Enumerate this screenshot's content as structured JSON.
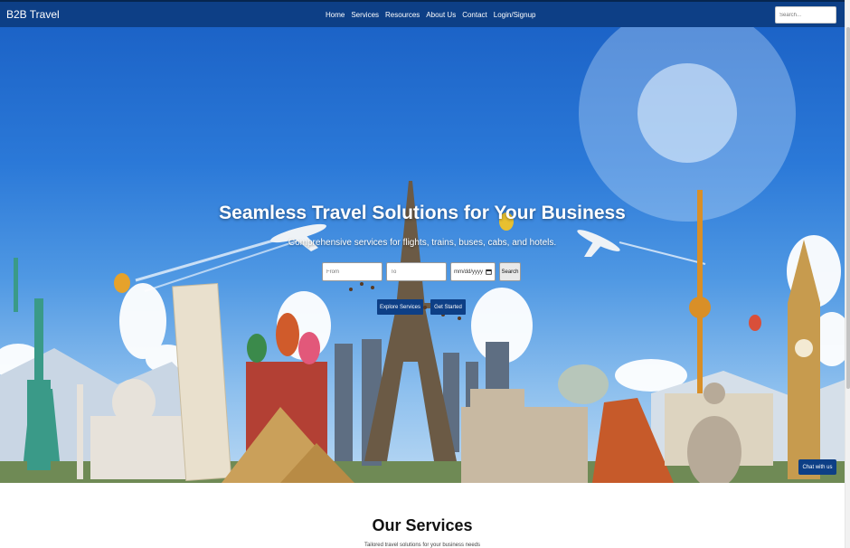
{
  "navbar": {
    "brand": "B2B Travel",
    "links": [
      "Home",
      "Services",
      "Resources",
      "About Us",
      "Contact",
      "Login/Signup"
    ],
    "search_placeholder": "Search..."
  },
  "hero": {
    "title": "Seamless Travel Solutions for Your Business",
    "subtitle": "Comprehensive services for flights, trains, buses, cabs, and hotels.",
    "search": {
      "from_placeholder": "From",
      "to_placeholder": "To",
      "date_placeholder": "mm/dd/yyyy",
      "button": "Search"
    },
    "buttons": {
      "explore": "Explore Services",
      "start": "Get Started"
    }
  },
  "chat": {
    "label": "Chat with us"
  },
  "services": {
    "title": "Our Services",
    "subtitle": "Tailored travel solutions for your business needs"
  },
  "colors": {
    "primary": "#0d3f86",
    "accent_dark": "#06264f"
  },
  "icons": {
    "calendar": "calendar-icon"
  }
}
